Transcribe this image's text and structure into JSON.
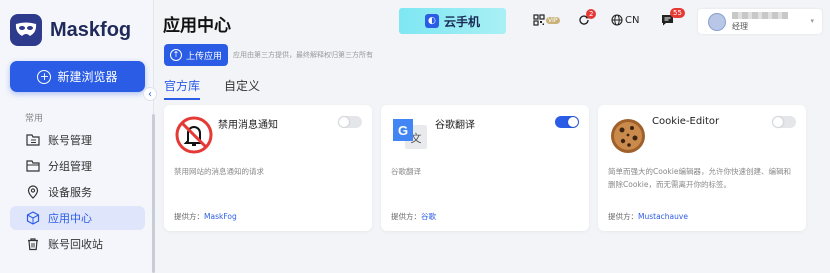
{
  "app": {
    "name": "Maskfog"
  },
  "sidebar": {
    "new_browser": "新建浏览器",
    "section_label": "常用",
    "items": [
      {
        "label": "账号管理",
        "icon": "folder-list-icon",
        "active": false
      },
      {
        "label": "分组管理",
        "icon": "folder-open-icon",
        "active": false
      },
      {
        "label": "设备服务",
        "icon": "location-pin-icon",
        "active": false
      },
      {
        "label": "应用中心",
        "icon": "cube-icon",
        "active": true
      },
      {
        "label": "账号回收站",
        "icon": "trash-icon",
        "active": false
      }
    ]
  },
  "header": {
    "title": "应用中心",
    "banner": "云手机",
    "vip_label": "VIP",
    "notif_count": "2",
    "lang": "CN",
    "msg_count": "55",
    "user_role": "经理"
  },
  "toolbar": {
    "upload": "上传应用",
    "hint": "应用由第三方提供，最终解释权归第三方所有"
  },
  "tabs": [
    "官方库",
    "自定义"
  ],
  "cards": [
    {
      "name": "禁用消息通知",
      "icon": "bell-off-icon",
      "enabled": false,
      "desc": "禁用网站的消息通知的请求",
      "provider_label": "提供方：",
      "provider": "MaskFog"
    },
    {
      "name": "谷歌翻译",
      "icon": "google-translate-icon",
      "enabled": true,
      "desc": "谷歌翻译",
      "provider_label": "提供方：",
      "provider": "谷歌"
    },
    {
      "name": "Cookie-Editor",
      "icon": "cookie-icon",
      "enabled": false,
      "desc": "简单而强大的Cookie编辑器，允许你快速创建、编辑和删除Cookie，而无需离开你的标签。",
      "provider_label": "提供方：",
      "provider": "Mustachauve"
    }
  ],
  "colors": {
    "accent": "#2b5ce6",
    "danger": "#e53935"
  }
}
